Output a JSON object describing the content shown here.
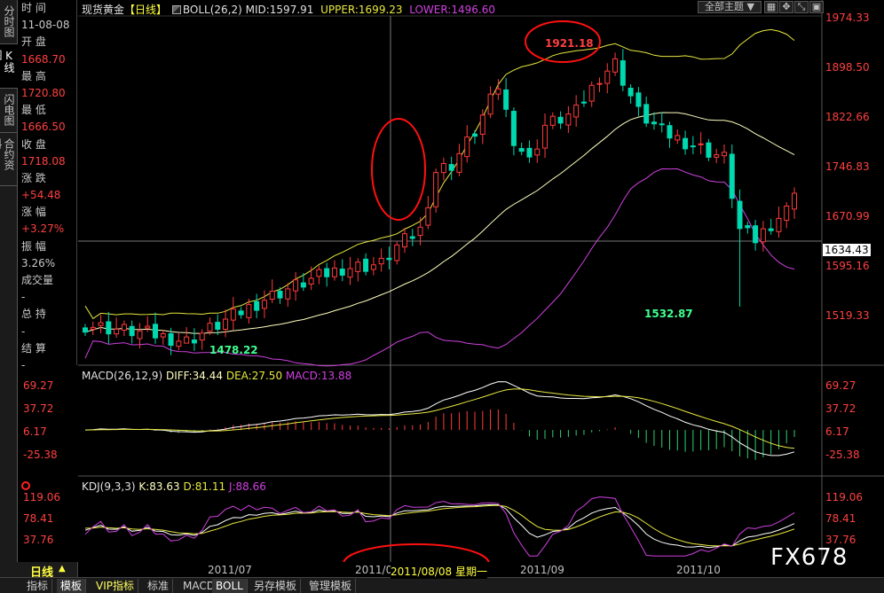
{
  "side_tabs": [
    "分时图",
    "K线图",
    "闪电图",
    "合约资料"
  ],
  "info_panel": {
    "rows": [
      {
        "label": "时 间",
        "value": "11-08-08",
        "color": "w"
      },
      {
        "label": "开 盘",
        "value": "1668.70",
        "color": "r"
      },
      {
        "label": "最 高",
        "value": "1720.80",
        "color": "r"
      },
      {
        "label": "最 低",
        "value": "1666.50",
        "color": "r"
      },
      {
        "label": "收 盘",
        "value": "1718.08",
        "color": "r"
      },
      {
        "label": "涨 跌",
        "value": "+54.48",
        "color": "r"
      },
      {
        "label": "涨 幅",
        "value": "+3.27%",
        "color": "r"
      },
      {
        "label": "振 幅",
        "value": "3.26%",
        "color": "w"
      },
      {
        "label": "成交量",
        "value": "-",
        "color": "w"
      },
      {
        "label": "总 持",
        "value": "-",
        "color": "w"
      },
      {
        "label": "结 算",
        "value": "-",
        "color": "w"
      }
    ]
  },
  "main_legend": {
    "instrument": "现货黄金",
    "period": "【日线】",
    "indicator": "BOLL(26,2)",
    "mid": "MID:1597.91",
    "upper": "UPPER:1699.23",
    "lower": "LOWER:1496.60"
  },
  "theme_select": "全部主题",
  "price_axis": [
    "1974.33",
    "1898.50",
    "1822.66",
    "1746.83",
    "1670.99",
    "1595.16",
    "1519.33"
  ],
  "crosshair_price": "1634.43",
  "annotations": {
    "high": "1921.18",
    "low_right": "1532.87",
    "low_left": "1478.22"
  },
  "macd": {
    "legend": {
      "name": "MACD(26,12,9)",
      "diff": "DIFF:34.44",
      "dea": "DEA:27.50",
      "macd": "MACD:13.88"
    },
    "axis": [
      "69.27",
      "37.72",
      "6.17",
      "-25.38"
    ]
  },
  "kdj": {
    "legend": {
      "name": "KDJ(9,3,3)",
      "k": "K:83.63",
      "d": "D:81.11",
      "j": "J:88.66"
    },
    "axis": [
      "119.06",
      "78.41",
      "37.76"
    ]
  },
  "time_axis": [
    "2011/07",
    "2011/0",
    "2011/09",
    "2011/10"
  ],
  "crosshair_date": "2011/08/08 星期一",
  "period_label": "日线",
  "watermark": "FX678",
  "bottom_tabs": [
    "指标",
    "模板",
    "VIP指标",
    "标准",
    "MACD",
    "BOLL",
    "另存模板",
    "管理模板"
  ],
  "colors": {
    "up": "#ff3b3b",
    "down": "#00d8b0",
    "mid": "#ffffc0",
    "upper": "#e8e840",
    "lower": "#d040e0",
    "circle": "#ff1010"
  }
}
